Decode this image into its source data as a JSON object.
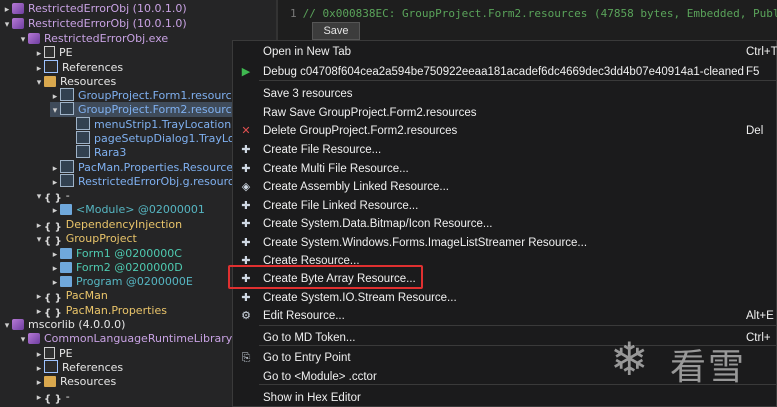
{
  "tree": [
    {
      "text": "RestrictedErrorObj (10.0.1.0)",
      "cls": "c-asm",
      "icon": "assembly-icon"
    },
    {
      "text": "RestrictedErrorObj (10.0.1.0)",
      "cls": "c-asm",
      "icon": "assembly-icon"
    },
    {
      "text": "RestrictedErrorObj.exe",
      "cls": "c-asm",
      "icon": "module-icon"
    },
    {
      "text": "PE",
      "cls": "c-white",
      "icon": "file-icon"
    },
    {
      "text": "References",
      "cls": "c-white",
      "icon": "references-icon"
    },
    {
      "text": "Resources",
      "cls": "c-white",
      "icon": "folder-icon"
    },
    {
      "text": "GroupProject.Form1.resources",
      "cls": "c-blue",
      "icon": "resource-icon"
    },
    {
      "text": "GroupProject.Form2.resources",
      "cls": "c-blue",
      "icon": "resource-icon"
    },
    {
      "text": "menuStrip1.TrayLocation",
      "cls": "c-blue",
      "icon": "resource-element-icon"
    },
    {
      "text": "pageSetupDialog1.TrayLoc",
      "cls": "c-blue",
      "icon": "resource-element-icon"
    },
    {
      "text": "Rara3",
      "cls": "c-blue",
      "icon": "resource-element-icon"
    },
    {
      "text": "PacMan.Properties.Resources.",
      "cls": "c-blue",
      "icon": "resource-icon"
    },
    {
      "text": "RestrictedErrorObj.g.resource",
      "cls": "c-blue",
      "icon": "resource-icon"
    },
    {
      "text": "-",
      "cls": "c-white",
      "icon": "namespace-icon"
    },
    {
      "text": "<Module> @02000001",
      "cls": "c-green",
      "icon": "class-icon"
    },
    {
      "text": "DependencyInjection",
      "cls": "c-orange",
      "icon": "namespace-icon"
    },
    {
      "text": "GroupProject",
      "cls": "c-orange",
      "icon": "namespace-icon"
    },
    {
      "text": "Form1 @0200000C",
      "cls": "c-teal",
      "icon": "class-icon"
    },
    {
      "text": "Form2 @0200000D",
      "cls": "c-teal",
      "icon": "class-icon"
    },
    {
      "text": "Program @0200000E",
      "cls": "c-green",
      "icon": "class-icon"
    },
    {
      "text": "PacMan",
      "cls": "c-orange",
      "icon": "namespace-icon"
    },
    {
      "text": "PacMan.Properties",
      "cls": "c-orange",
      "icon": "namespace-icon"
    },
    {
      "text": "mscorlib (4.0.0.0)",
      "cls": "c-white",
      "icon": "assembly-icon"
    },
    {
      "text": "CommonLanguageRuntimeLibrary",
      "cls": "c-asm",
      "icon": "module-icon"
    },
    {
      "text": "PE",
      "cls": "c-white",
      "icon": "file-icon"
    },
    {
      "text": "References",
      "cls": "c-white",
      "icon": "references-icon"
    },
    {
      "text": "Resources",
      "cls": "c-white",
      "icon": "folder-icon"
    },
    {
      "text": "-",
      "cls": "c-white",
      "icon": "namespace-icon"
    }
  ],
  "code": {
    "line_number": "1",
    "line_text": "// 0x000838EC: GroupProject.Form2.resources (47858 bytes, Embedded, Public)",
    "save_label": "Save"
  },
  "menu": [
    {
      "label": "Open in New Tab",
      "key": "Ctrl+T",
      "icon": ""
    },
    {
      "label": "Debug c04708f604cea2a594be750922eeaa181acadef6dc4669dec3dd4b07e40914a1-cleaned",
      "key": "F5",
      "icon": "play-icon"
    },
    {
      "label": "Save 3 resources",
      "key": "",
      "icon": ""
    },
    {
      "label": "Raw Save GroupProject.Form2.resources",
      "key": "",
      "icon": ""
    },
    {
      "label": "Delete GroupProject.Form2.resources",
      "key": "Del",
      "icon": "delete-icon"
    },
    {
      "label": "Create File Resource...",
      "key": "",
      "icon": "new-file-icon"
    },
    {
      "label": "Create Multi File Resource...",
      "key": "",
      "icon": "new-file-icon"
    },
    {
      "label": "Create Assembly Linked Resource...",
      "key": "",
      "icon": "assembly-link-icon"
    },
    {
      "label": "Create File Linked Resource...",
      "key": "",
      "icon": "new-file-icon"
    },
    {
      "label": "Create System.Data.Bitmap/Icon Resource...",
      "key": "",
      "icon": "new-file-icon"
    },
    {
      "label": "Create System.Windows.Forms.ImageListStreamer Resource...",
      "key": "",
      "icon": "new-file-icon"
    },
    {
      "label": "Create Resource...",
      "key": "",
      "icon": "new-file-icon"
    },
    {
      "label": "Create Byte Array Resource...",
      "key": "",
      "icon": "new-file-icon"
    },
    {
      "label": "Create System.IO.Stream Resource...",
      "key": "",
      "icon": "new-file-icon"
    },
    {
      "label": "Edit Resource...",
      "key": "Alt+E",
      "icon": "gear-icon"
    },
    {
      "label": "Go to MD Token...",
      "key": "Ctrl+",
      "icon": ""
    },
    {
      "label": "Go to Entry Point",
      "key": "",
      "icon": "entry-point-icon"
    },
    {
      "label": "Go to <Module> .cctor",
      "key": "",
      "icon": ""
    },
    {
      "label": "Show in Hex Editor",
      "key": "",
      "icon": ""
    }
  ],
  "watermark": {
    "text": "看雪"
  },
  "colors": {
    "highlight": "#e03030",
    "play": "#3fb950",
    "delete": "#e05050"
  }
}
